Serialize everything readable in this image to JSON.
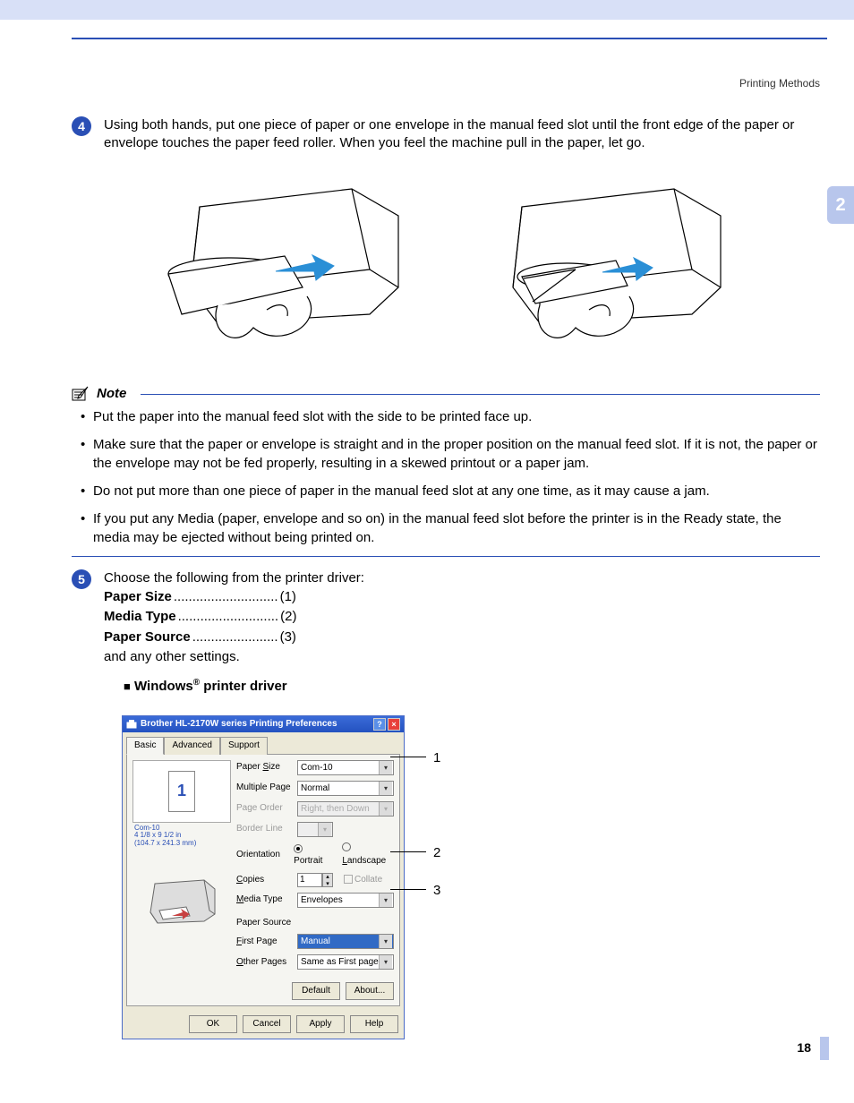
{
  "header": {
    "label": "Printing Methods"
  },
  "side_tab": "2",
  "step4": {
    "num": "4",
    "text": "Using both hands, put one piece of paper or one envelope in the manual feed slot until the front edge of the paper or envelope touches the paper feed roller. When you feel the machine pull in the paper, let go."
  },
  "note": {
    "title": "Note",
    "items": [
      "Put the paper into the manual feed slot with the side to be printed face up.",
      "Make sure that the paper or envelope is straight and in the proper position on the manual feed slot. If it is not, the paper or the envelope may not be fed properly, resulting in a skewed printout or a paper jam.",
      "Do not put more than one piece of paper in the manual feed slot at any one time, as it may cause a jam.",
      "If you put any Media (paper, envelope and so on) in the manual feed slot before the printer is in the Ready state, the media may be ejected without being printed on."
    ]
  },
  "step5": {
    "num": "5",
    "intro": "Choose the following from the printer driver:",
    "lines": [
      {
        "label": "Paper Size",
        "dots": "............................",
        "ref": "(1)"
      },
      {
        "label": "Media Type",
        "dots": "...........................",
        "ref": "(2)"
      },
      {
        "label": "Paper Source",
        "dots": ".......................",
        "ref": "(3)"
      }
    ],
    "outro": "and any other settings.",
    "subheading_prefix": "Windows",
    "subheading_suffix": " printer driver"
  },
  "dialog": {
    "title": "Brother HL-2170W series Printing Preferences",
    "tabs": [
      "Basic",
      "Advanced",
      "Support"
    ],
    "preview_meta": {
      "l1": "Com-10",
      "l2": "4 1/8 x 9 1/2 in",
      "l3": "(104.7 x 241.3 mm)"
    },
    "preview_num": "1",
    "fields": {
      "paper_size": {
        "label": "Paper Size",
        "value": "Com-10"
      },
      "multiple_page": {
        "label": "Multiple Page",
        "value": "Normal"
      },
      "page_order": {
        "label": "Page Order",
        "value": "Right, then Down"
      },
      "border_line": {
        "label": "Border Line",
        "value": ""
      },
      "orientation": {
        "label": "Orientation",
        "portrait": "Portrait",
        "landscape": "Landscape"
      },
      "copies": {
        "label": "Copies",
        "value": "1",
        "collate": "Collate"
      },
      "media_type": {
        "label": "Media Type",
        "value": "Envelopes"
      },
      "paper_source": {
        "label": "Paper Source"
      },
      "first_page": {
        "label": "First Page",
        "value": "Manual"
      },
      "other_pages": {
        "label": "Other Pages",
        "value": "Same as First page"
      }
    },
    "mid_buttons": {
      "default": "Default",
      "about": "About..."
    },
    "bottom_buttons": {
      "ok": "OK",
      "cancel": "Cancel",
      "apply": "Apply",
      "help": "Help"
    }
  },
  "callouts": {
    "c1": "1",
    "c2": "2",
    "c3": "3"
  },
  "page_number": "18"
}
